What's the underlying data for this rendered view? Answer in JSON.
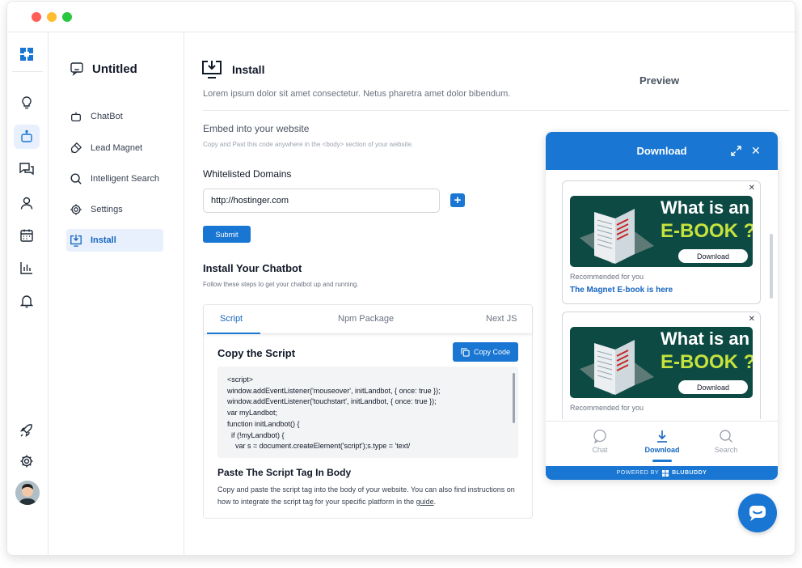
{
  "window": {
    "controls": [
      "close",
      "minimize",
      "maximize"
    ]
  },
  "rail": {
    "items": [
      {
        "name": "ideas-icon"
      },
      {
        "name": "bot-icon",
        "active": true
      },
      {
        "name": "chat-icon"
      },
      {
        "name": "user-icon"
      },
      {
        "name": "calendar-icon"
      },
      {
        "name": "analytics-icon"
      },
      {
        "name": "bell-icon"
      }
    ],
    "bottom": [
      "rocket-icon",
      "gear-icon",
      "avatar"
    ]
  },
  "subnav": {
    "title": "Untitled",
    "items": [
      {
        "label": "ChatBot",
        "icon": "bot-icon"
      },
      {
        "label": "Lead Magnet",
        "icon": "magnet-icon"
      },
      {
        "label": "Intelligent Search",
        "icon": "search-icon"
      },
      {
        "label": "Settings",
        "icon": "gear-icon"
      },
      {
        "label": "Install",
        "icon": "install-icon",
        "active": true
      }
    ]
  },
  "main": {
    "title": "Install",
    "description": "Lorem ipsum dolor sit amet consectetur. Netus pharetra amet dolor bibendum.",
    "embed": {
      "title": "Embed into your website",
      "description": "Copy and Past this code anywhere in the <body> section of your website."
    },
    "whitelist": {
      "title": "Whitelisted Domains",
      "domain_value": "http://hostinger.com",
      "add_label": "+",
      "submit_label": "Submit"
    },
    "install": {
      "title": "Install Your Chatbot",
      "description": "Follow these steps to get your chatbot up and running.",
      "tabs": [
        "Script",
        "Npm Package",
        "Next JS"
      ],
      "active_tab": "Script",
      "copy_title": "Copy the Script",
      "copy_button": "Copy Code",
      "code": "<script>\nwindow.addEventListener('mouseover', initLandbot, { once: true });\nwindow.addEventListener('touchstart', initLandbot, { once: true });\nvar myLandbot;\nfunction initLandbot() {\n  if (!myLandbot) {\n    var s = document.createElement('script');s.type = 'text/",
      "paste_title": "Paste The Script Tag In Body",
      "paste_desc": "Copy and paste the script tag into the body of your website. You can also find instructions on how to integrate the script tag for your specific platform in the ",
      "guide_link": "guide",
      "paste_end": "."
    }
  },
  "preview": {
    "title": "Preview",
    "widget": {
      "title": "Download",
      "cards": [
        {
          "line1": "What is an",
          "line2": "E-BOOK ?",
          "button": "Download",
          "recommended": "Recommended for you",
          "link": "The Magnet E-book is here"
        },
        {
          "line1": "What is an",
          "line2": "E-BOOK ?",
          "button": "Download",
          "recommended": "Recommended for you"
        }
      ],
      "nav": [
        {
          "label": "Chat",
          "icon": "chat-bubble-icon"
        },
        {
          "label": "Download",
          "icon": "download-icon",
          "active": true
        },
        {
          "label": "Search",
          "icon": "search-icon"
        }
      ],
      "powered_by": "POWERED BY",
      "brand": "BLUBUDDY"
    }
  },
  "colors": {
    "accent": "#1976d2",
    "banner": "#0d4a43",
    "banner_highlight": "#c5e23e"
  }
}
